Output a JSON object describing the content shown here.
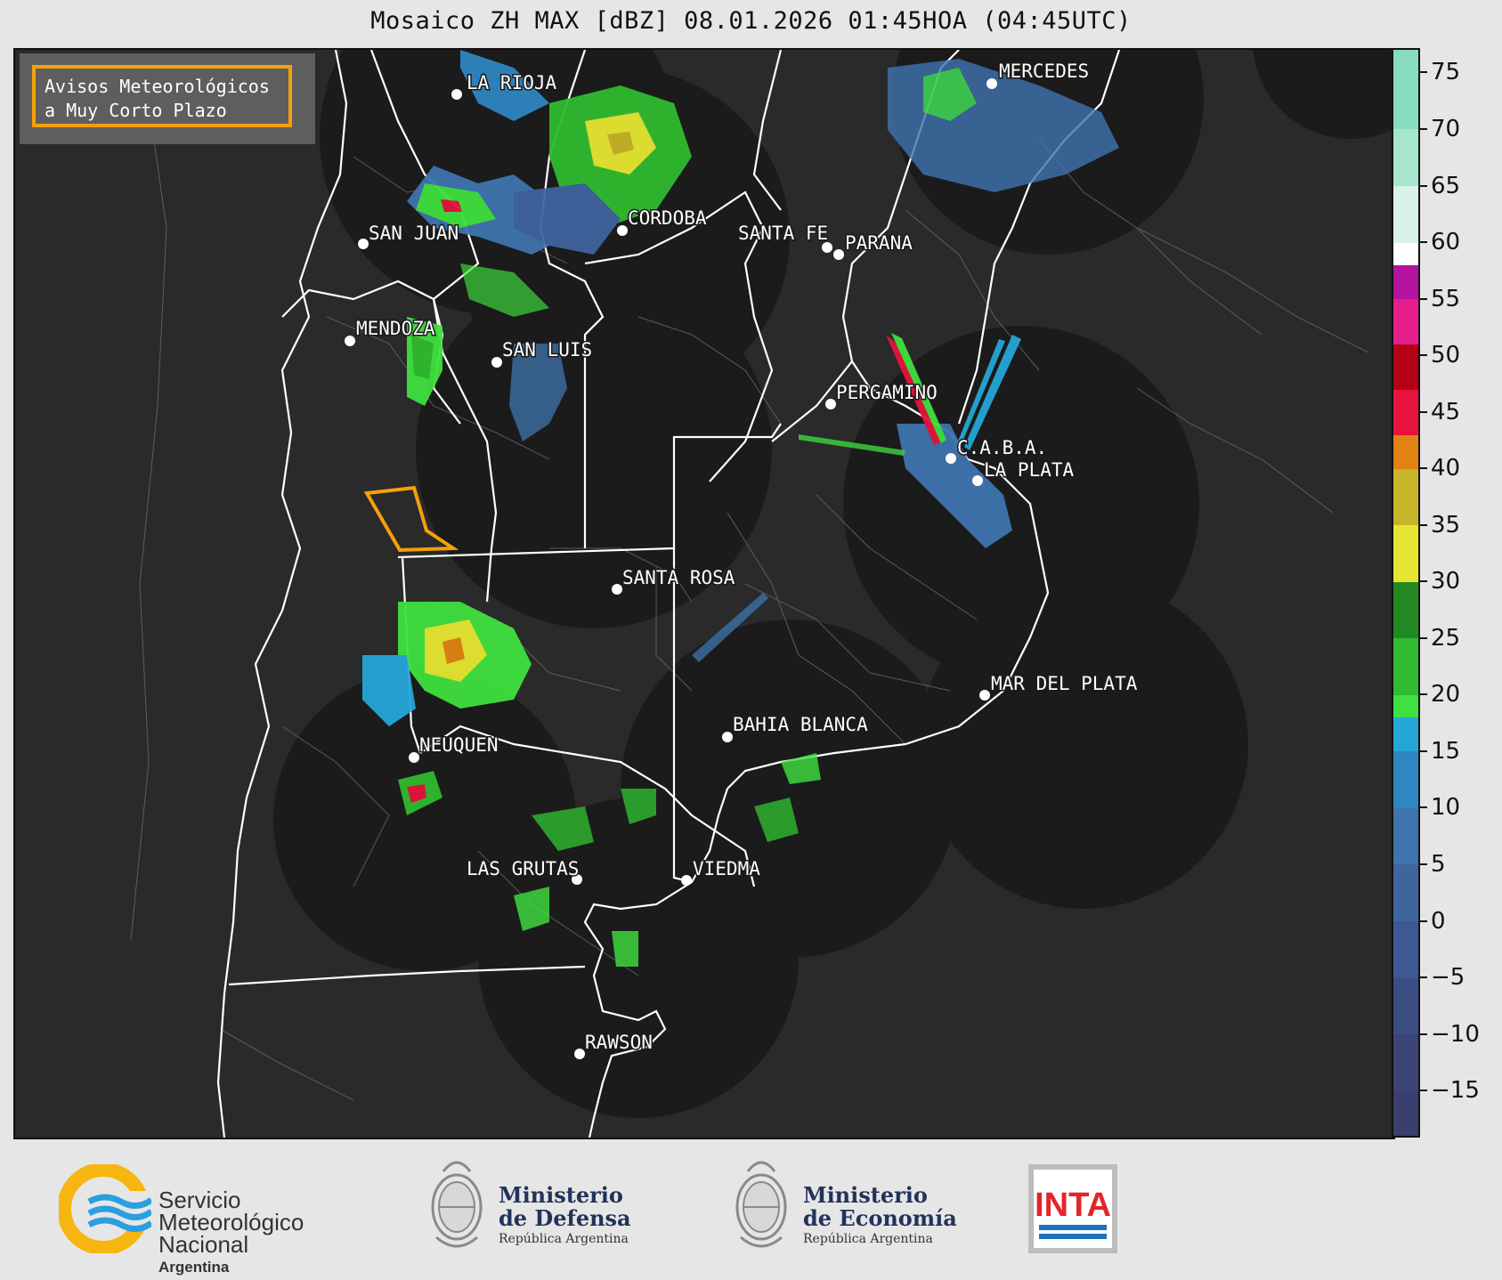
{
  "title": "Mosaico ZH MAX [dBZ] 08.01.2026 01:45HOA (04:45UTC)",
  "warning_box": {
    "line1": "Avisos Meteorológicos",
    "line2": "a Muy Corto Plazo",
    "border_color": "#f5a00a"
  },
  "cities": [
    {
      "name": "LA RIOJA"
    },
    {
      "name": "MERCEDES"
    },
    {
      "name": "SAN JUAN"
    },
    {
      "name": "CORDOBA"
    },
    {
      "name": "SANTA FE"
    },
    {
      "name": "PARANA"
    },
    {
      "name": "MENDOZA"
    },
    {
      "name": "SAN LUIS"
    },
    {
      "name": "PERGAMINO"
    },
    {
      "name": "C.A.B.A."
    },
    {
      "name": "LA PLATA"
    },
    {
      "name": "SANTA ROSA"
    },
    {
      "name": "MAR DEL PLATA"
    },
    {
      "name": "BAHIA BLANCA"
    },
    {
      "name": "NEUQUEN"
    },
    {
      "name": "LAS GRUTAS"
    },
    {
      "name": "VIEDMA"
    },
    {
      "name": "RAWSON"
    }
  ],
  "colorbar": {
    "unit": "dBZ",
    "min": -19,
    "max": 77,
    "tick_labels": [
      "75",
      "70",
      "65",
      "60",
      "55",
      "50",
      "45",
      "40",
      "35",
      "30",
      "25",
      "20",
      "15",
      "10",
      "5",
      "0",
      "−5",
      "−10",
      "−15"
    ],
    "tick_values": [
      75,
      70,
      65,
      60,
      55,
      50,
      45,
      40,
      35,
      30,
      25,
      20,
      15,
      10,
      5,
      0,
      -5,
      -10,
      -15
    ],
    "bands": [
      {
        "from": -19,
        "to": -15,
        "color": "#3a3f6e"
      },
      {
        "from": -15,
        "to": -10,
        "color": "#3b4577"
      },
      {
        "from": -10,
        "to": -5,
        "color": "#3c4d83"
      },
      {
        "from": -5,
        "to": 0,
        "color": "#3e5891"
      },
      {
        "from": 0,
        "to": 5,
        "color": "#3f659f"
      },
      {
        "from": 5,
        "to": 10,
        "color": "#3f74ae"
      },
      {
        "from": 10,
        "to": 15,
        "color": "#2f86c0"
      },
      {
        "from": 15,
        "to": 18,
        "color": "#26a6d8"
      },
      {
        "from": 18,
        "to": 20,
        "color": "#3fe03f"
      },
      {
        "from": 20,
        "to": 25,
        "color": "#30bb30"
      },
      {
        "from": 25,
        "to": 30,
        "color": "#238a23"
      },
      {
        "from": 30,
        "to": 35,
        "color": "#e6e632"
      },
      {
        "from": 35,
        "to": 40,
        "color": "#c8b428"
      },
      {
        "from": 40,
        "to": 43,
        "color": "#e08214"
      },
      {
        "from": 43,
        "to": 47,
        "color": "#e6143c"
      },
      {
        "from": 47,
        "to": 51,
        "color": "#b40014"
      },
      {
        "from": 51,
        "to": 55,
        "color": "#e61e8c"
      },
      {
        "from": 55,
        "to": 58,
        "color": "#b414a0"
      },
      {
        "from": 58,
        "to": 60,
        "color": "#ffffff"
      },
      {
        "from": 60,
        "to": 65,
        "color": "#d8f2e8"
      },
      {
        "from": 65,
        "to": 70,
        "color": "#a6e6cc"
      },
      {
        "from": 70,
        "to": 77,
        "color": "#86dcbc"
      }
    ]
  },
  "logos": {
    "smn": {
      "line1": "Servicio",
      "line2": "Meteorológico",
      "line3": "Nacional",
      "country": "Argentina"
    },
    "defensa": {
      "line1": "Ministerio",
      "line2": "de Defensa",
      "sub": "República Argentina"
    },
    "economia": {
      "line1": "Ministerio",
      "line2": "de Economía",
      "sub": "República Argentina"
    },
    "inta": {
      "text": "INTA"
    }
  },
  "colors": {
    "map_background": "#2a2a2a",
    "radar_coverage": "#1b1b1b",
    "boundary": "#ffffff",
    "warning_polygon": "#f5a00a"
  }
}
